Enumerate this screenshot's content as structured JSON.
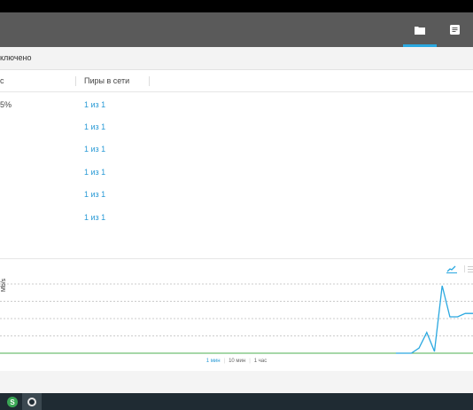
{
  "status": {
    "text": "ключено"
  },
  "table": {
    "columns": [
      "с",
      "Пиры в сети"
    ],
    "rows": [
      {
        "progress": "5%",
        "peers": "1 из 1"
      },
      {
        "progress": "",
        "peers": "1 из 1"
      },
      {
        "progress": "",
        "peers": "1 из 1"
      },
      {
        "progress": "",
        "peers": "1 из 1"
      },
      {
        "progress": "",
        "peers": "1 из 1"
      },
      {
        "progress": "",
        "peers": "1 из 1"
      }
    ]
  },
  "graph": {
    "ylabel": "Mb/s",
    "ranges": [
      "1 мин",
      "10 мин",
      "1 час"
    ],
    "active_range": "1 мин",
    "accent_color": "#2aa8e0",
    "baseline_color": "#4caf50"
  },
  "chart_data": {
    "type": "line",
    "x": [
      0,
      1,
      2,
      3,
      4,
      5,
      6,
      7,
      8,
      9,
      10
    ],
    "series": [
      {
        "values": [
          0,
          0,
          0,
          0.3,
          1.2,
          0.1,
          3.9,
          2.1,
          2.1,
          2.3,
          2.3
        ]
      }
    ],
    "xlabel": "",
    "ylabel": "Mb/s",
    "ylim": [
      0,
      4
    ],
    "grid": true
  },
  "header": {
    "icons": [
      "folder-icon",
      "list-icon"
    ]
  },
  "taskbar": {
    "items": [
      "s-app-icon",
      "circle-app-icon"
    ]
  }
}
